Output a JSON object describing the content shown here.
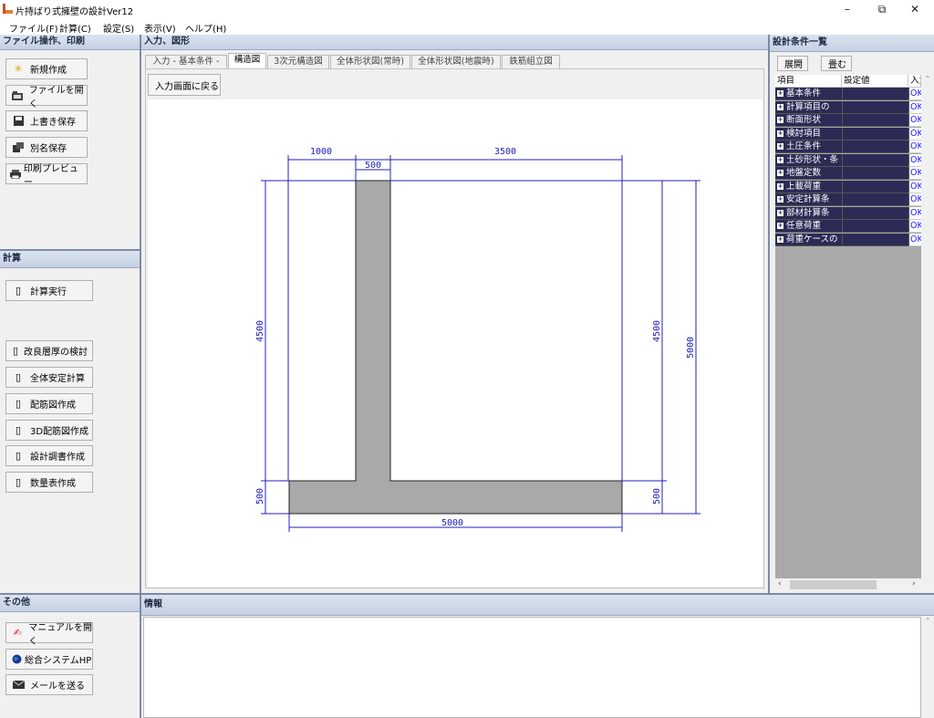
{
  "window": {
    "title": "片持ばり式擁壁の設計Ver12",
    "minimize": "–",
    "restore": "⧉",
    "close": "✕"
  },
  "menu": [
    "ファイル(F)",
    "計算(C)",
    "設定(S)",
    "表示(V)",
    "ヘルプ(H)"
  ],
  "left": {
    "file_header": "ファイル操作、印刷",
    "file_buttons": [
      {
        "label": "新規作成",
        "icon": "new-icon"
      },
      {
        "label": "ファイルを開く",
        "icon": "open-folder-icon"
      },
      {
        "label": "上書き保存",
        "icon": "save-icon"
      },
      {
        "label": "別名保存",
        "icon": "save-as-icon"
      },
      {
        "label": "印刷プレビュー",
        "icon": "print-icon"
      }
    ],
    "calc_header": "計算",
    "calc_run": "計算実行",
    "calc_buttons": [
      "改良層厚の検討",
      "全体安定計算",
      "配筋図作成",
      "3D配筋図作成",
      "設計調書作成",
      "数量表作成"
    ],
    "other_header": "その他",
    "other_buttons": [
      {
        "label": "マニュアルを開く",
        "icon": "manual-icon"
      },
      {
        "label": "総合システムHP",
        "icon": "globe-icon"
      },
      {
        "label": "メールを送る",
        "icon": "mail-icon"
      }
    ]
  },
  "center": {
    "header": "入力、図形",
    "tabs": [
      "入力 - 基本条件 -",
      "構造図",
      "3次元構造図",
      "全体形状図(常時)",
      "全体形状図(地震時)",
      "鉄筋組立図"
    ],
    "active_tab": 1,
    "back_button": "入力画面に戻る",
    "drawing": {
      "dims": {
        "top_left": "1000",
        "top_stem": "500",
        "top_right": "3500",
        "left_height": "4500",
        "left_base": "500",
        "right_height": "4500",
        "right_total": "5000",
        "right_base": "500",
        "bottom_width": "5000"
      }
    }
  },
  "info": {
    "header": "情報"
  },
  "right": {
    "header": "設計条件一覧",
    "expand": "展開",
    "collapse": "畳む",
    "columns": [
      "項目",
      "設定値",
      "入力"
    ],
    "rows": [
      {
        "name": "基本条件",
        "status": "OK"
      },
      {
        "name": "計算項目の",
        "status": "OK"
      },
      {
        "name": "断面形状",
        "status": "OK"
      },
      {
        "name": "検討項目",
        "status": "OK"
      },
      {
        "name": "土圧条件",
        "status": "OK"
      },
      {
        "name": "土砂形状・条",
        "status": "OK"
      },
      {
        "name": "地盤定数",
        "status": "OK"
      },
      {
        "name": "上載荷重",
        "status": "OK"
      },
      {
        "name": "安定計算条",
        "status": "OK"
      },
      {
        "name": "部材計算条",
        "status": "OK"
      },
      {
        "name": "任意荷重",
        "status": "OK"
      },
      {
        "name": "荷重ケースの",
        "status": "OK"
      }
    ]
  },
  "colors": {
    "panel_header": "#c5d1e3",
    "grid_row": "#2c2b55",
    "dim_line": "#2020c0",
    "wall_fill": "#a9a9a9"
  }
}
